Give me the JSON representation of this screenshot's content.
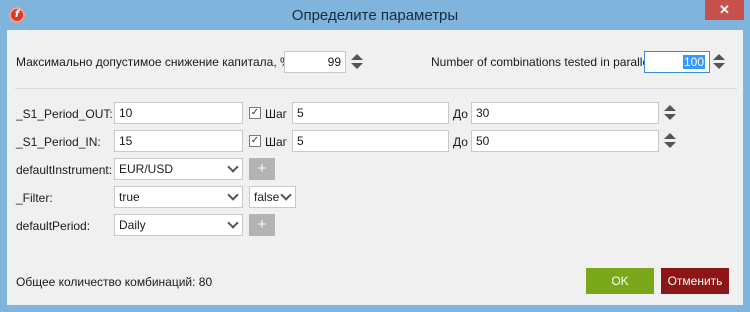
{
  "window": {
    "title": "Определите параметры",
    "close_symbol": "✕",
    "app_icon_letter": "f"
  },
  "top": {
    "drawdown_label": "Максимально допустимое снижение капитала, %",
    "drawdown_value": "99",
    "parallel_label": "Number of combinations tested in parallel",
    "parallel_value": "100"
  },
  "params": [
    {
      "name": "_S1_Period_OUT:",
      "from": "10",
      "step_label": "Шаг",
      "step": "5",
      "to_label": "До",
      "to": "30",
      "checked": true
    },
    {
      "name": "_S1_Period_IN:",
      "from": "15",
      "step_label": "Шаг",
      "step": "5",
      "to_label": "До",
      "to": "50",
      "checked": true
    }
  ],
  "instrument": {
    "label": "defaultInstrument:",
    "value": "EUR/USD",
    "add": "+"
  },
  "filter": {
    "label": "_Filter:",
    "value": "true",
    "value2": "false"
  },
  "period": {
    "label": "defaultPeriod:",
    "value": "Daily",
    "add": "+"
  },
  "footer": {
    "total_label": "Общее количество комбинаций: 80",
    "ok": "OK",
    "cancel": "Отменить"
  }
}
